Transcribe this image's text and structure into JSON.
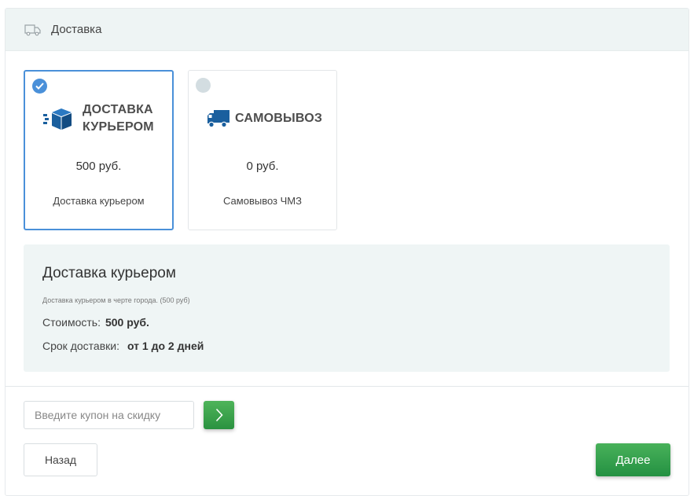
{
  "header": {
    "title": "Доставка",
    "icon": "truck-icon"
  },
  "options": [
    {
      "logo_line1": "ДОСТАВКА",
      "logo_line2": "КУРЬЕРОМ",
      "price": "500 руб.",
      "name": "Доставка курьером",
      "selected": true,
      "icon": "box-icon",
      "icon_color": "#1a5f9e"
    },
    {
      "logo_line1": "САМОВЫВОЗ",
      "price": "0 руб.",
      "name": "Самовывоз ЧМЗ",
      "selected": false,
      "icon": "delivery-truck-icon",
      "icon_color": "#1a5f9e"
    }
  ],
  "details": {
    "title": "Доставка курьером",
    "description": "Доставка курьером в черте города. (500 руб)",
    "cost_label": "Стоимость:",
    "cost_value": "500 руб.",
    "term_label": "Срок доставки:",
    "term_value": "от 1 до 2 дней"
  },
  "coupon": {
    "placeholder": "Введите купон на скидку",
    "value": ""
  },
  "buttons": {
    "back": "Назад",
    "next": "Далее"
  },
  "colors": {
    "accent": "#4a90d9",
    "primary_button": "#2a9240",
    "panel_bg": "#eef4f4"
  }
}
